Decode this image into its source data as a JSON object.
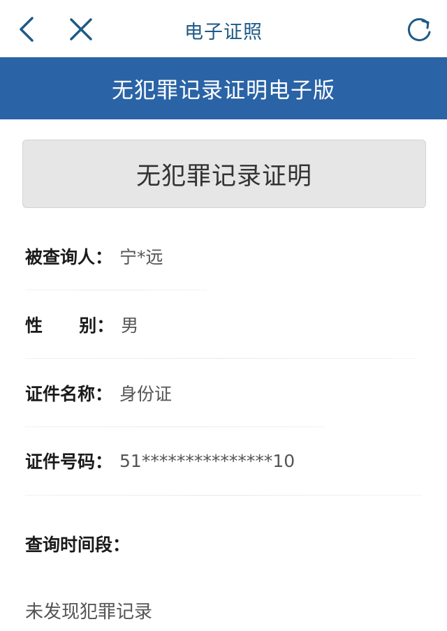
{
  "nav": {
    "title": "电子证照",
    "back_icon": "chevron-left-icon",
    "close_icon": "close-icon",
    "refresh_icon": "refresh-icon",
    "icon_color": "#1e5a86"
  },
  "banner": {
    "title": "无犯罪记录证明电子版",
    "color": "#2a63a6"
  },
  "certificate": {
    "title": "无犯罪记录证明"
  },
  "fields": {
    "subject": {
      "label": "被查询人：",
      "value": "宁*远"
    },
    "gender": {
      "label": "性      别：",
      "value": "男"
    },
    "id_type": {
      "label": "证件名称：",
      "value": "身份证"
    },
    "id_number": {
      "label": "证件号码：",
      "value": "51***************10"
    },
    "period": {
      "label": "查询时间段："
    }
  },
  "result": "未发现犯罪记录"
}
